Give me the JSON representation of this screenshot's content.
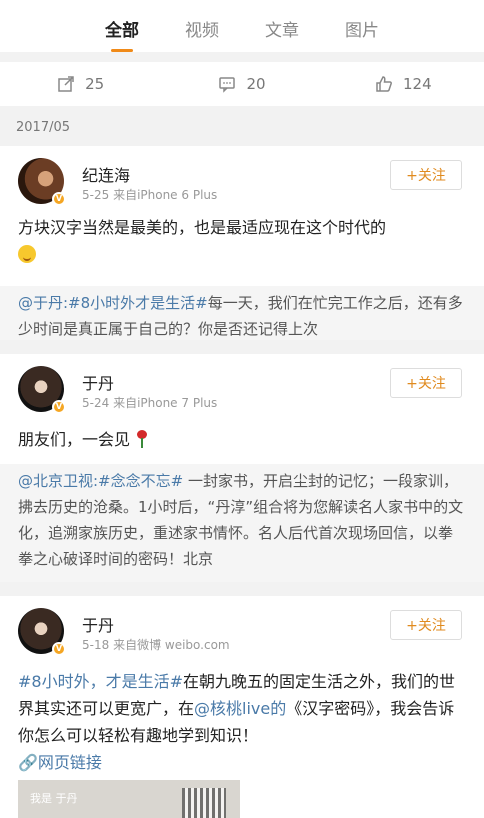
{
  "tabs": [
    {
      "label": "全部",
      "active": true
    },
    {
      "label": "视频"
    },
    {
      "label": "文章"
    },
    {
      "label": "图片"
    }
  ],
  "actions": {
    "repost": "25",
    "comment": "20",
    "like": "124"
  },
  "month_label": "2017/05",
  "posts": [
    {
      "name": "纪连海",
      "date": "5-25",
      "source": "来自iPhone 6 Plus",
      "follow": "+关注",
      "text": "方块汉字当然是最美的，也是最适应现在这个时代的",
      "repost_hl": "@于丹:#8小时外才是生活#",
      "repost_text": "每一天，我们在忙完工作之后，还有多少时间是真正属于自己的？你是否还记得上次"
    },
    {
      "name": "于丹",
      "date": "5-24",
      "source": "来自iPhone 7 Plus",
      "follow": "+关注",
      "text": "朋友们，一会见",
      "repost_hl": "@北京卫视:#念念不忘#",
      "repost_text": " 一封家书，开启尘封的记忆；一段家训，拂去历史的沧桑。1小时后，“丹淳”组合将为您解读名人家书中的文化，追溯家族历史，重述家书情怀。名人后代首次现场回信，以拳拳之心破译时间的密码！北京"
    },
    {
      "name": "于丹",
      "date": "5-18",
      "source": "来自微博 weibo.com",
      "follow": "+关注",
      "text_hl1": "#8小时外，才是生活#",
      "text_mid": "在朝九晚五的固定生活之外，我们的世界其实还可以更宽广，在",
      "text_hl2": "@核桃live的",
      "text_end": "《汉字密码》，我会告诉你怎么可以轻松有趣地学到知识！",
      "link": "网页链接",
      "card_text": "我是 于丹"
    }
  ],
  "colors": {
    "accent": "#f08a18",
    "link": "#4a7aa8",
    "follow": "#e08a1e"
  }
}
